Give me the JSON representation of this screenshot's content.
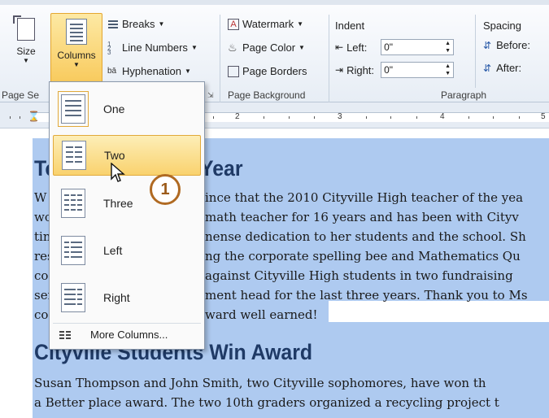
{
  "ribbon": {
    "page_setup": {
      "size_label": "Size",
      "columns_label": "Columns",
      "breaks_label": "Breaks",
      "line_numbers_label": "Line Numbers",
      "hyphenation_label": "Hyphenation",
      "group_label": "Page Se"
    },
    "page_background": {
      "watermark_label": "Watermark",
      "page_color_label": "Page Color",
      "page_borders_label": "Page Borders",
      "group_label": "Page Background"
    },
    "paragraph": {
      "indent_label": "Indent",
      "left_label": "Left:",
      "left_value": "0\"",
      "right_label": "Right:",
      "right_value": "0\"",
      "spacing_label": "Spacing",
      "before_label": "Before:",
      "after_label": "After:",
      "group_label": "Paragraph"
    }
  },
  "ruler": {
    "numbers": [
      "2",
      "3",
      "4",
      "5"
    ]
  },
  "columns_menu": {
    "items": [
      {
        "label": "One"
      },
      {
        "label": "Two"
      },
      {
        "label": "Three"
      },
      {
        "label": "Left"
      },
      {
        "label": "Right"
      }
    ],
    "more_label": "More Columns..."
  },
  "callout": {
    "number": "1"
  },
  "document": {
    "heading1_prefix": "To",
    "heading1_suffix": "Year",
    "lines": [
      {
        "left": "W",
        "right": "ince that the 2010 Cityville High teacher of the yea"
      },
      {
        "left": "wo",
        "right": "math teacher for 16 years and has been with Cityv"
      },
      {
        "left": "tin",
        "right": "nense dedication to her students and the school. Sh"
      },
      {
        "left": "res",
        "right": "ng the corporate spelling bee and Mathematics Qu"
      },
      {
        "left": "co",
        "right": "against Cityville High students in two fundraising"
      },
      {
        "left": "ser",
        "right": "ment head for the last three years. Thank you to Ms"
      },
      {
        "left": "co",
        "right": "ward well earned!"
      }
    ],
    "heading2": "Cityville Students Win Award",
    "para2_line1": "Susan Thompson and John Smith, two Cityville sophomores, have won th",
    "para2_line2": "a Better place award. The two 10th graders organized a recycling project t"
  },
  "colors": {
    "selection": "#aecaf0",
    "heading": "#1f3a66",
    "menu_highlight": "#f9d26e",
    "callout_border": "#b06a22"
  }
}
